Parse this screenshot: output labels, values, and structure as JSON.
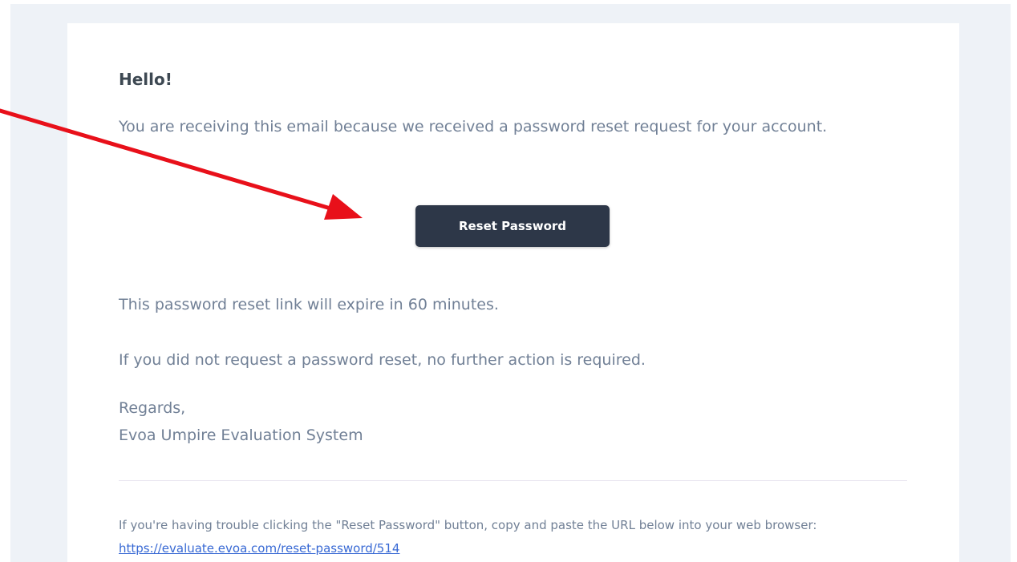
{
  "email": {
    "greeting": "Hello!",
    "intro": "You are receiving this email because we received a password reset request for your account.",
    "button_label": "Reset Password",
    "expire_text": "This password reset link will expire in 60 minutes.",
    "no_action_text": "If you did not request a password reset, no further action is required.",
    "regards": "Regards,",
    "signature": "Evoa Umpire Evaluation System",
    "subcopy_text": "If you're having trouble clicking the \"Reset Password\" button, copy and paste the URL below into your web browser: ",
    "reset_url": "https://evaluate.evoa.com/reset-password/514"
  },
  "annotation": {
    "arrow_color": "#e8101a"
  },
  "colors": {
    "button_bg": "#2d3748",
    "body_text": "#718096",
    "heading_text": "#3d4852",
    "link": "#3869d4",
    "backdrop": "#eef2f7"
  }
}
